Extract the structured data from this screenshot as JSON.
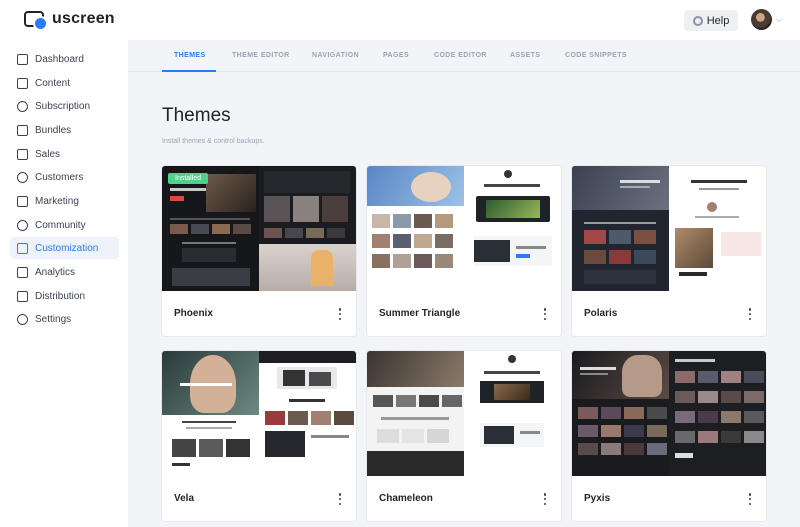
{
  "app": {
    "brand": "uscreen",
    "help_label": "Help"
  },
  "sidebar": {
    "items": [
      {
        "label": "Dashboard",
        "icon": "grid-icon",
        "active": false
      },
      {
        "label": "Content",
        "icon": "folder-icon",
        "active": false
      },
      {
        "label": "Subscription",
        "icon": "refresh-icon",
        "active": false
      },
      {
        "label": "Bundles",
        "icon": "box-icon",
        "active": false
      },
      {
        "label": "Sales",
        "icon": "money-icon",
        "active": false
      },
      {
        "label": "Customers",
        "icon": "users-icon",
        "active": false
      },
      {
        "label": "Marketing",
        "icon": "megaphone-icon",
        "active": false
      },
      {
        "label": "Community",
        "icon": "chat-icon",
        "active": false
      },
      {
        "label": "Customization",
        "icon": "edit-icon",
        "active": true
      },
      {
        "label": "Analytics",
        "icon": "chart-icon",
        "active": false
      },
      {
        "label": "Distribution",
        "icon": "devices-icon",
        "active": false
      },
      {
        "label": "Settings",
        "icon": "gear-icon",
        "active": false
      }
    ]
  },
  "tabs": [
    {
      "label": "THEMES",
      "active": true
    },
    {
      "label": "THEME EDITOR",
      "active": false
    },
    {
      "label": "NAVIGATION",
      "active": false
    },
    {
      "label": "PAGES",
      "active": false
    },
    {
      "label": "CODE EDITOR",
      "active": false
    },
    {
      "label": "ASSETS",
      "active": false
    },
    {
      "label": "CODE SNIPPETS",
      "active": false
    }
  ],
  "page": {
    "title": "Themes",
    "subtitle": "Install themes & control backups."
  },
  "themes": [
    {
      "name": "Phoenix",
      "badge": "Installed"
    },
    {
      "name": "Summer Triangle"
    },
    {
      "name": "Polaris"
    },
    {
      "name": "Vela"
    },
    {
      "name": "Chameleon"
    },
    {
      "name": "Pyxis"
    }
  ],
  "colors": {
    "accent": "#2b7bf3",
    "installed_badge": "#4fd18b",
    "main_bg": "#f2f4f7"
  }
}
